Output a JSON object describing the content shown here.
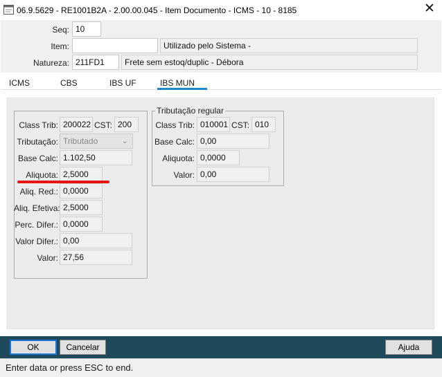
{
  "window": {
    "title": "06.9.5629 - RE1001B2A - 2.00.00.045 - Item Documento - ICMS - 10 - 8185",
    "close_glyph": "✕"
  },
  "header": {
    "seq_label": "Seq:",
    "seq_value": "10",
    "item_label": "Item:",
    "item_code": "",
    "item_desc": "Utilizado pelo Sistema -",
    "natureza_label": "Natureza:",
    "natureza_code": "211FD1",
    "natureza_desc": "Frete sem estoq/duplic - Débora"
  },
  "tabs": [
    {
      "label": "ICMS",
      "active": false
    },
    {
      "label": "CBS",
      "active": false
    },
    {
      "label": "IBS UF",
      "active": false
    },
    {
      "label": "IBS MUN",
      "active": true
    }
  ],
  "left_group": {
    "class_trib_label": "Class Trib:",
    "class_trib_value": "200022",
    "cst_label": "CST:",
    "cst_value": "200",
    "tributacao_label": "Tributação:",
    "tributacao_value": "Tributado",
    "base_calc_label": "Base Calc:",
    "base_calc_value": "1.102,50",
    "aliquota_label": "Aliquota:",
    "aliquota_value": "2,5000",
    "aliq_red_label": "Aliq. Red.:",
    "aliq_red_value": "0,0000",
    "aliq_efetiva_label": "Aliq. Efetiva:",
    "aliq_efetiva_value": "2,5000",
    "perc_difer_label": "Perc. Difer.:",
    "perc_difer_value": "0,0000",
    "valor_difer_label": "Valor Difer.:",
    "valor_difer_value": "0,00",
    "valor_label": "Valor:",
    "valor_value": "27,56"
  },
  "right_group": {
    "title": "Tributação regular",
    "class_trib_label": "Class Trib:",
    "class_trib_value": "010001",
    "cst_label": "CST:",
    "cst_value": "010",
    "base_calc_label": "Base Calc:",
    "base_calc_value": "0,00",
    "aliquota_label": "Aliquota:",
    "aliquota_value": "0,0000",
    "valor_label": "Valor:",
    "valor_value": "0,00"
  },
  "buttons": {
    "ok": "OK",
    "cancel": "Cancelar",
    "help": "Ajuda"
  },
  "status": "Enter data or press ESC to end.",
  "colors": {
    "accent_tab": "#1e88c8",
    "annotation_red": "#e81313",
    "bottom_bar": "#1e4a5c"
  }
}
